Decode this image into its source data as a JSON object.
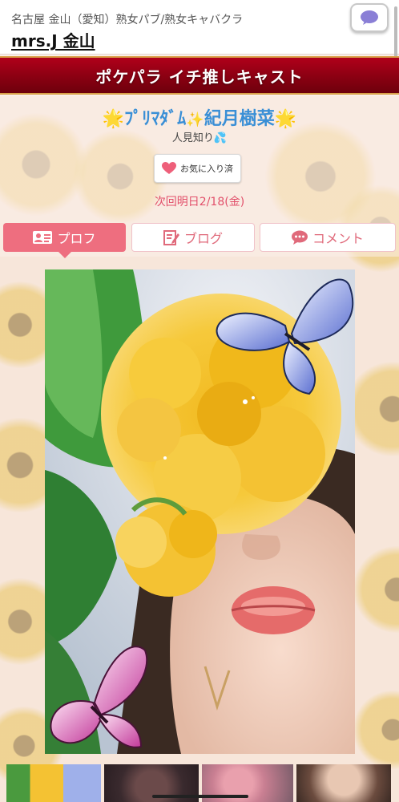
{
  "header": {
    "subtitle": "名古屋 金山（愛知）熟女パブ/熟女キャバクラ",
    "shop_name": "mrs.J 金山",
    "chat_icon": "speech-bubble-icon"
  },
  "banner": {
    "title": "ポケパラ イチ推しキャスト"
  },
  "cast": {
    "name_prefix": "ﾌﾟﾘﾏﾀﾞﾑ",
    "name": "紀月樹菜",
    "tagline": "人見知り",
    "favorite_label": "お気に入り済",
    "next_shift": "次回明日2/18(金)"
  },
  "tabs": [
    {
      "label": "プロフ",
      "icon": "profile-card-icon",
      "active": true
    },
    {
      "label": "ブログ",
      "icon": "edit-icon",
      "active": false
    },
    {
      "label": "コメント",
      "icon": "chat-icon",
      "active": false
    }
  ],
  "colors": {
    "accent": "#ee6e7f",
    "banner": "#8a0012",
    "name": "#3a8fd6",
    "date": "#e2506b"
  }
}
